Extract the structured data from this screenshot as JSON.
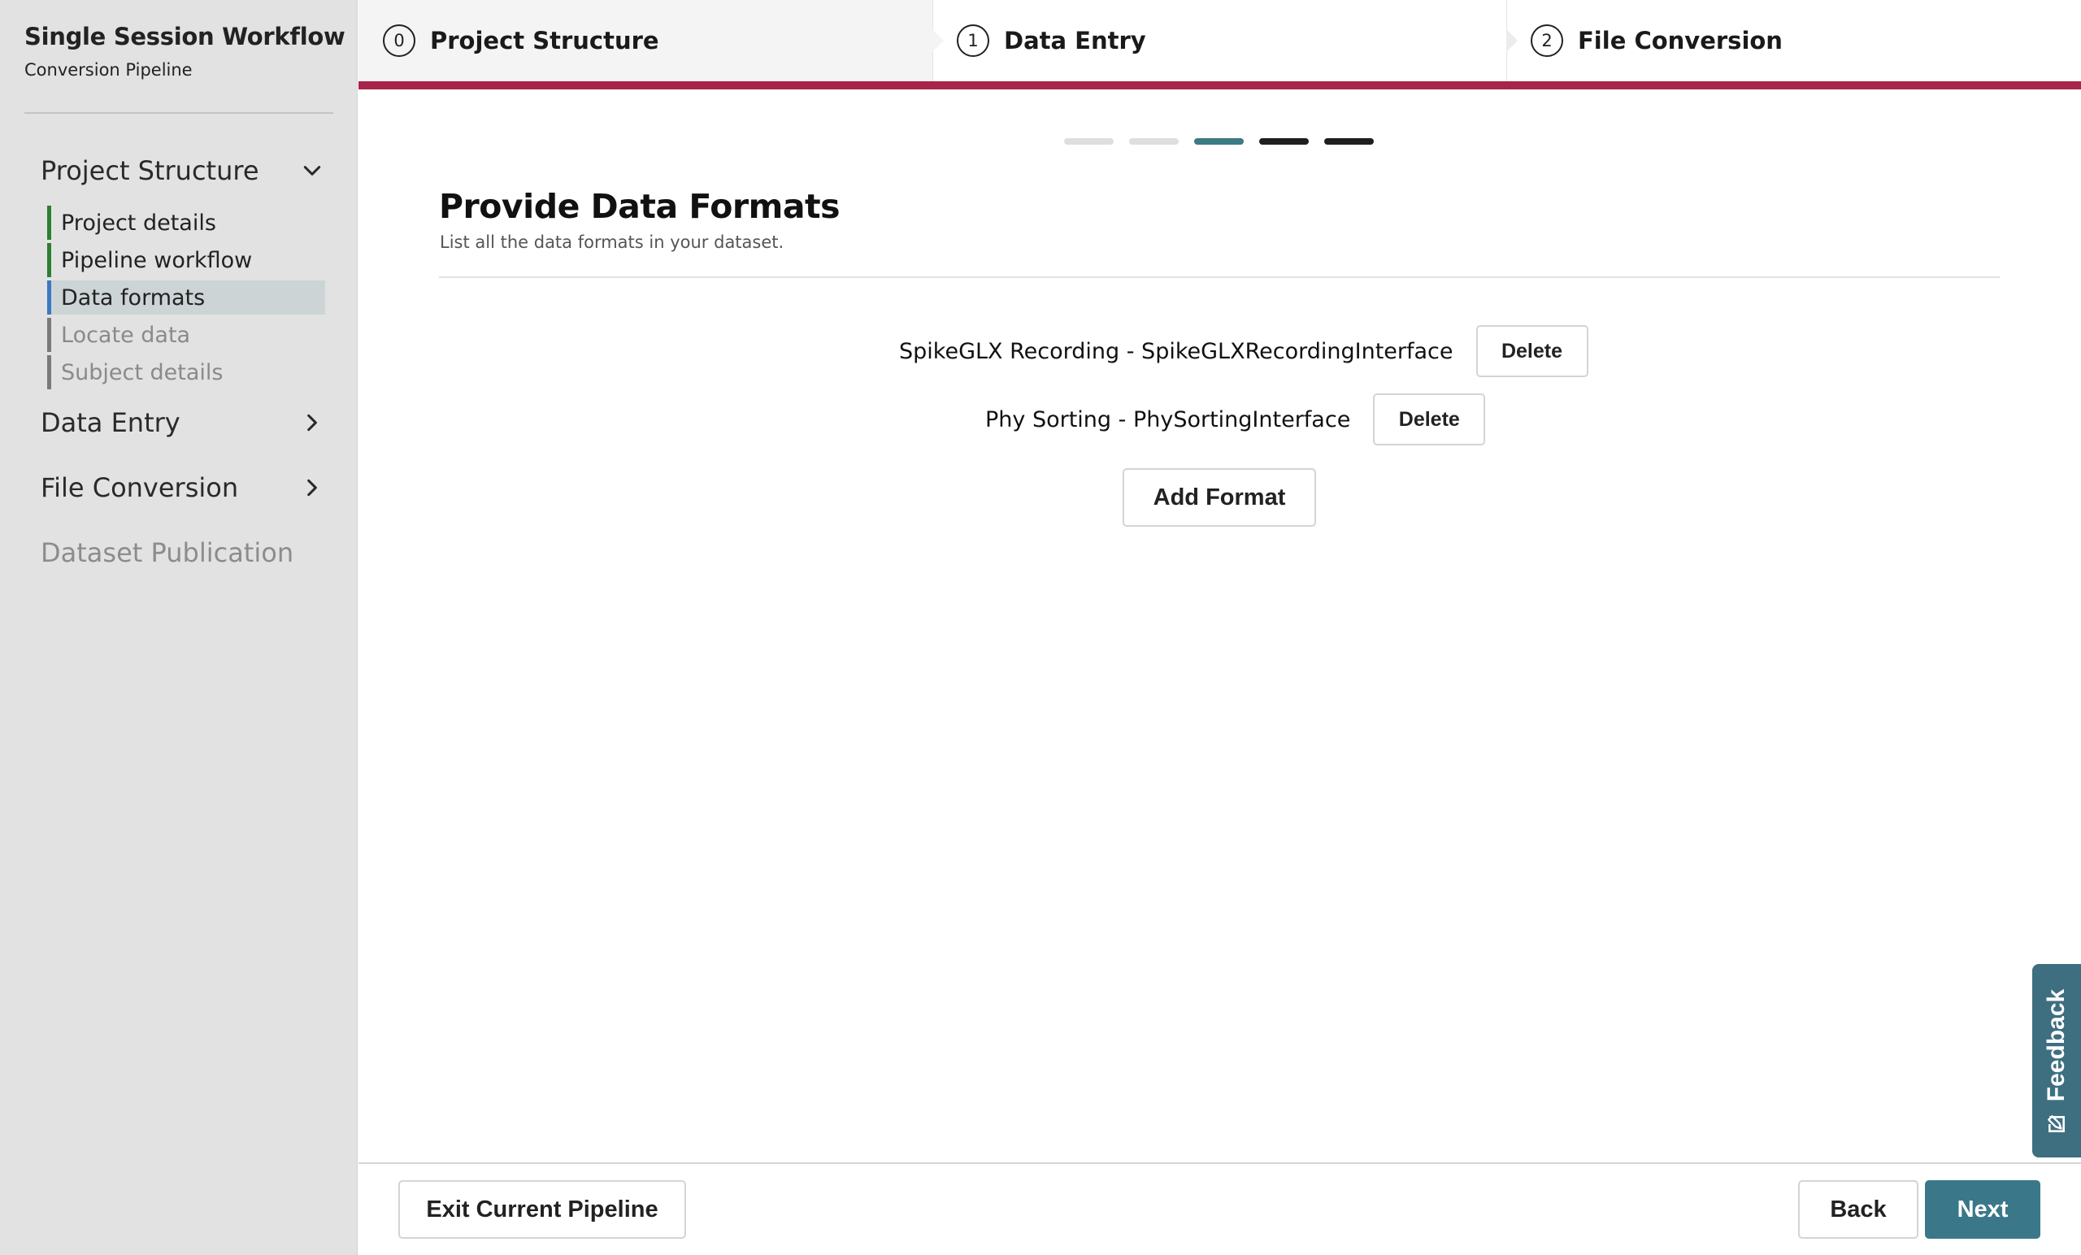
{
  "sidebar": {
    "title": "Single Session Workflow",
    "subtitle": "Conversion Pipeline",
    "sections": [
      {
        "label": "Project Structure",
        "state": "expanded",
        "icon": "chevron-down-icon"
      },
      {
        "label": "Data Entry",
        "state": "collapsed",
        "icon": "chevron-right-icon"
      },
      {
        "label": "File Conversion",
        "state": "collapsed",
        "icon": "chevron-right-icon"
      },
      {
        "label": "Dataset Publication",
        "state": "disabled"
      }
    ],
    "sub_items": [
      {
        "label": "Project details",
        "status": "complete"
      },
      {
        "label": "Pipeline workflow",
        "status": "complete"
      },
      {
        "label": "Data formats",
        "status": "active"
      },
      {
        "label": "Locate data",
        "status": "pending"
      },
      {
        "label": "Subject details",
        "status": "pending"
      }
    ]
  },
  "stepper": {
    "steps": [
      {
        "number": "0",
        "label": "Project Structure"
      },
      {
        "number": "1",
        "label": "Data Entry"
      },
      {
        "number": "2",
        "label": "File Conversion"
      }
    ]
  },
  "progress_dots": {
    "total": 5,
    "current_index": 2,
    "colors": {
      "done": "#dedede",
      "current": "#3d7a82",
      "upcoming": "#1f1f1f"
    }
  },
  "main": {
    "title": "Provide Data Formats",
    "subtitle": "List all the data formats in your dataset.",
    "formats": [
      {
        "label": "SpikeGLX Recording - SpikeGLXRecordingInterface",
        "delete_label": "Delete"
      },
      {
        "label": "Phy Sorting - PhySortingInterface",
        "delete_label": "Delete"
      }
    ],
    "add_label": "Add Format"
  },
  "footer": {
    "exit_label": "Exit Current Pipeline",
    "back_label": "Back",
    "next_label": "Next"
  },
  "feedback": {
    "label": "Feedback",
    "icon": "edit-icon"
  },
  "colors": {
    "accent": "#a8244a",
    "primary": "#3a7889",
    "complete": "#2e7d32",
    "active": "#3b78c2",
    "feedback": "#3d6f80"
  }
}
